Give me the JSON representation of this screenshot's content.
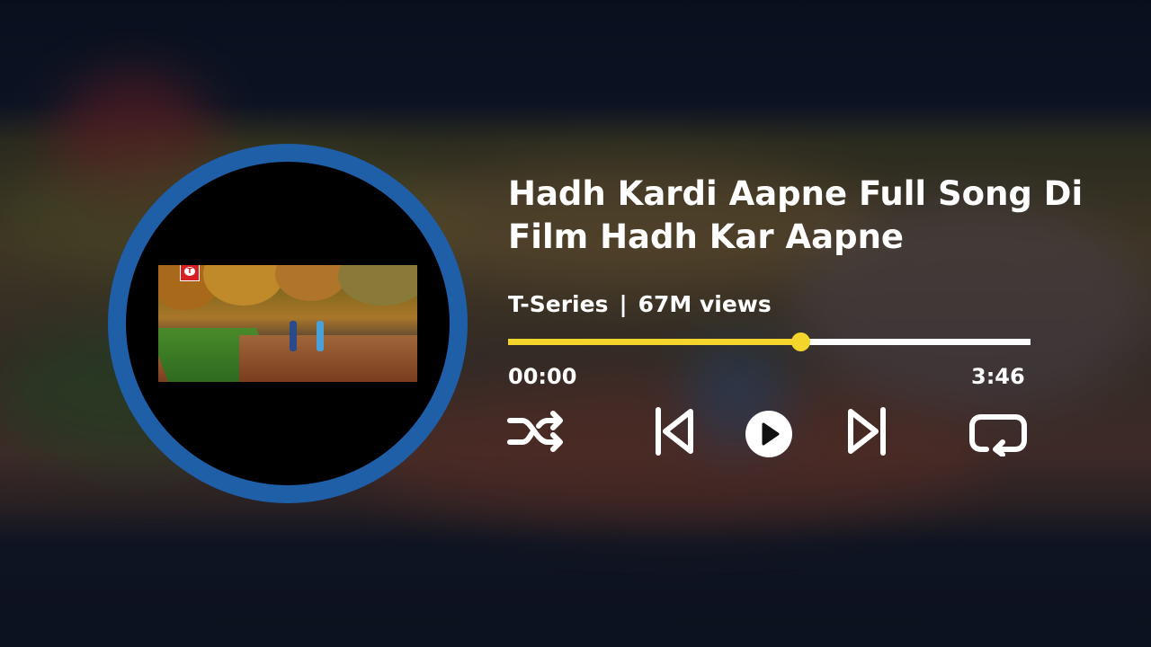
{
  "player": {
    "title_line1": "Hadh Kardi Aapne Full Song Di",
    "title_line2": "Film Hadh Kar Aapne",
    "channel": "T-Series",
    "separator": "|",
    "views": "67M views",
    "current_time": "00:00",
    "duration": "3:46",
    "progress_fraction": 0.56,
    "thumbnail_logo_text": "T",
    "colors": {
      "accent": "#f3d52b",
      "disc_ring": "#1e5fa8",
      "text": "#ffffff"
    }
  },
  "controls": [
    {
      "name": "shuffle-icon"
    },
    {
      "name": "previous-icon"
    },
    {
      "name": "play-icon"
    },
    {
      "name": "next-icon"
    },
    {
      "name": "repeat-icon"
    }
  ]
}
